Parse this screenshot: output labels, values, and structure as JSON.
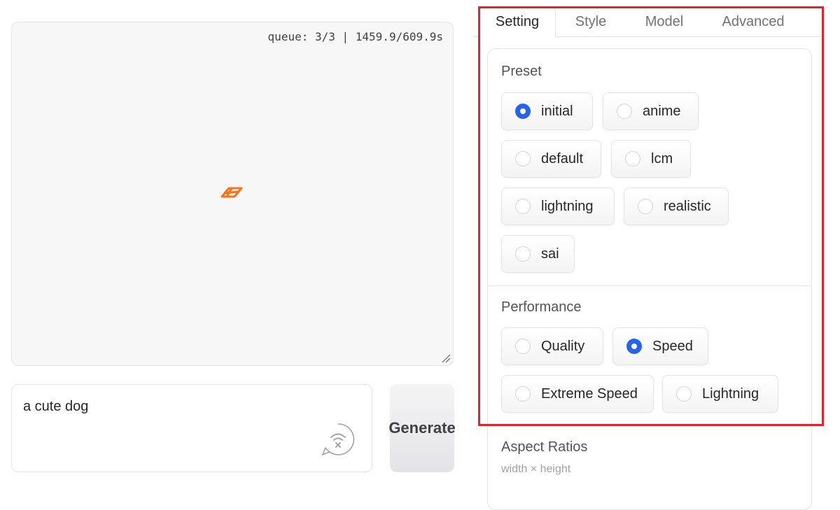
{
  "output": {
    "queue_status": "queue: 3/3 | 1459.9/609.9s",
    "loading_icon": "fooocus-logo-icon",
    "resize_icon": "resize-handle-icon"
  },
  "prompt": {
    "value": "a cute dog",
    "icon": "wifi-clear-icon"
  },
  "generate": {
    "label": "Generate"
  },
  "tabs": [
    {
      "label": "Setting",
      "active": true
    },
    {
      "label": "Style",
      "active": false
    },
    {
      "label": "Model",
      "active": false
    },
    {
      "label": "Advanced",
      "active": false
    }
  ],
  "preset": {
    "label": "Preset",
    "selected": "initial",
    "options": [
      "initial",
      "anime",
      "default",
      "lcm",
      "lightning",
      "realistic",
      "sai"
    ]
  },
  "performance": {
    "label": "Performance",
    "selected": "Speed",
    "options": [
      "Quality",
      "Speed",
      "Extreme Speed",
      "Lightning"
    ]
  },
  "aspect_ratios": {
    "label": "Aspect Ratios",
    "sublabel": "width × height"
  },
  "colors": {
    "accent": "#2563eb",
    "highlight": "#e0242d",
    "logo": "#f97316"
  }
}
